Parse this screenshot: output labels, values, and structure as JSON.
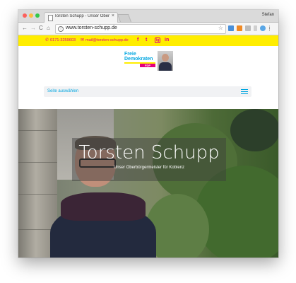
{
  "browser": {
    "tab_title": "Torsten Schupp - Unser Oberbürgermeister",
    "tab_close": "×",
    "profile_name": "Stefan",
    "nav_back": "←",
    "nav_forward": "→",
    "nav_reload": "C",
    "nav_home": "⌂",
    "info_glyph": "i",
    "url": "www.torsten-schupp.de",
    "bookmark_star": "☆"
  },
  "contact": {
    "phone_icon": "phone-icon",
    "phone": "0171-3259603",
    "mail_icon": "mail-icon",
    "email": "mail@torsten-schupp.de",
    "social": [
      "f",
      "t",
      "ig",
      "in"
    ],
    "accent_color": "#e5007d",
    "bar_color": "#ffed00"
  },
  "logo": {
    "line1": "Freie",
    "line2": "Demokraten",
    "badge": "FDP"
  },
  "menu": {
    "select_label": "Seite auswählen"
  },
  "hero": {
    "title": "Torsten Schupp",
    "subtitle": "Unser Oberbürgermeister für Koblenz"
  }
}
